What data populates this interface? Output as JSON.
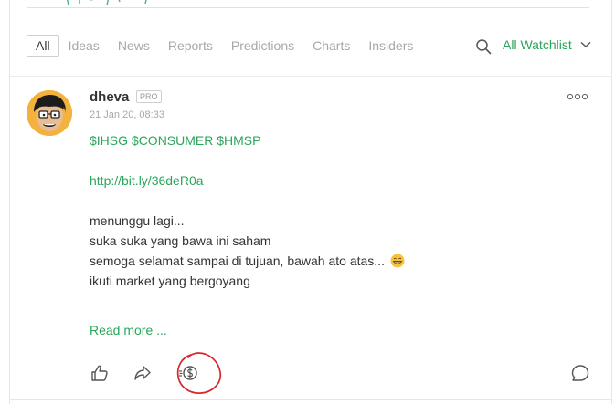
{
  "tabs": [
    {
      "label": "All",
      "active": true
    },
    {
      "label": "Ideas",
      "active": false
    },
    {
      "label": "News",
      "active": false
    },
    {
      "label": "Reports",
      "active": false
    },
    {
      "label": "Predictions",
      "active": false
    },
    {
      "label": "Charts",
      "active": false
    },
    {
      "label": "Insiders",
      "active": false
    }
  ],
  "watchlist": {
    "label": "All Watchlist"
  },
  "post": {
    "username": "dheva",
    "badge": "PRO",
    "timestamp": "21 Jan 20, 08:33",
    "tickers": "$IHSG $CONSUMER $HMSP",
    "link": "http://bit.ly/36deR0a",
    "lines": [
      "menunggu lagi...",
      "suka suka yang bawa ini saham",
      "semoga selamat sampai di tujuan, bawah ato atas...",
      "ikuti market yang bergoyang"
    ],
    "read_more": "Read more ..."
  },
  "icons": {
    "search": "search-icon",
    "more": "more-icon",
    "like": "thumbs-up-icon",
    "share": "share-icon",
    "tip": "tip-coin-icon",
    "comment": "comment-icon",
    "emoji": "grinning-emoji-icon"
  },
  "colors": {
    "accent": "#2aa55a",
    "highlight": "#d9252c"
  }
}
